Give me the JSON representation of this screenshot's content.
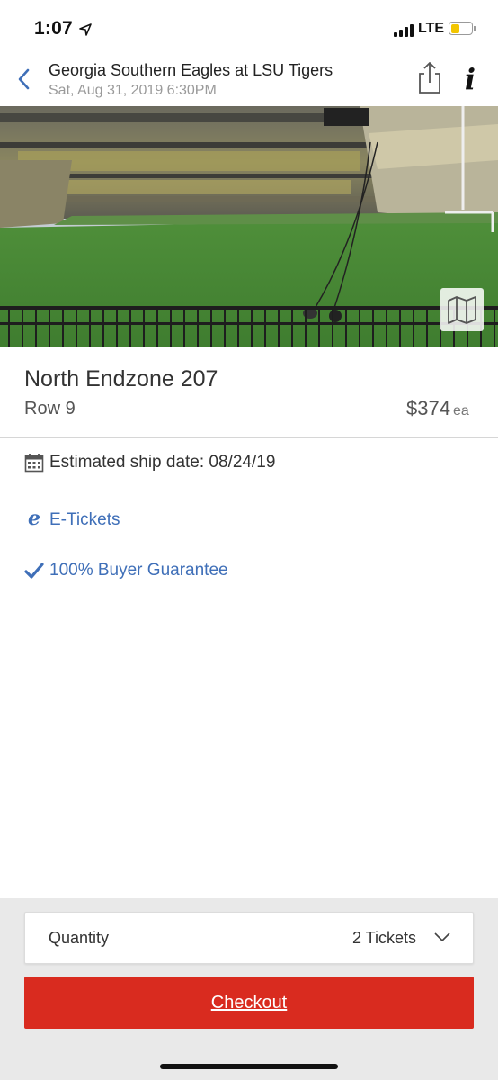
{
  "status_bar": {
    "time": "1:07",
    "network": "LTE"
  },
  "header": {
    "title": "Georgia Southern Eagles at LSU Tigers",
    "date": "Sat, Aug 31, 2019 6:30PM",
    "icons": [
      "back-icon",
      "share-icon",
      "info-icon"
    ]
  },
  "listing": {
    "section": "North Endzone 207",
    "row": "Row 9",
    "price": "$374",
    "price_unit": "ea"
  },
  "features": {
    "ship_date": "Estimated ship date: 08/24/19",
    "e_tickets": "E-Tickets",
    "e_glyph": "e",
    "guarantee": "100% Buyer Guarantee"
  },
  "purchase": {
    "quantity_label": "Quantity",
    "quantity_value": "2 Tickets",
    "checkout_label": "Checkout"
  },
  "colors": {
    "accent_blue": "#3f6fb8",
    "checkout_red": "#d92b1f",
    "panel_gray": "#e9e9e9"
  }
}
